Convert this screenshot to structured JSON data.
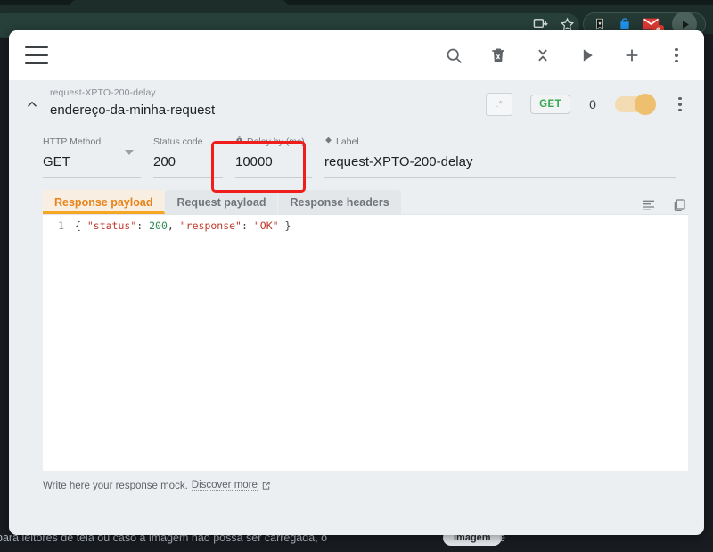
{
  "browser": {
    "icons": [
      {
        "name": "install-app-icon"
      },
      {
        "name": "bookmark-star-icon"
      },
      {
        "name": "extension-bookmark-icon"
      },
      {
        "name": "extension-shield-icon"
      },
      {
        "name": "gmail-extension-icon",
        "badge": "6"
      },
      {
        "name": "profile-avatar-icon"
      }
    ]
  },
  "toolbar": {
    "menu_label": "menu",
    "actions": [
      {
        "name": "search-icon",
        "label": "Search"
      },
      {
        "name": "delete-all-icon",
        "label": "Delete all"
      },
      {
        "name": "collapse-all-icon",
        "label": "Collapse all"
      },
      {
        "name": "run-icon",
        "label": "Run"
      },
      {
        "name": "add-icon",
        "label": "Add"
      },
      {
        "name": "more-options-icon",
        "label": "More options"
      }
    ]
  },
  "request": {
    "subtitle": "request-XPTO-200-delay",
    "title": "endereço-da-minha-request",
    "filter_value": ".*",
    "method_badge": "GET",
    "hit_count": "0",
    "enabled": true,
    "toggle_color": "#edbf6e",
    "method_color": "#34a853"
  },
  "fields": [
    {
      "name": "http-method-field",
      "label": "HTTP Method",
      "value": "GET",
      "icon": null,
      "select": true
    },
    {
      "name": "status-code-field",
      "label": "Status code",
      "value": "200",
      "icon": null,
      "select": false
    },
    {
      "name": "delay-field",
      "label": "Delay by (ms)",
      "value": "10000",
      "icon": "timer-icon",
      "select": false,
      "highlighted": true
    },
    {
      "name": "label-field",
      "label": "Label",
      "value": "request-XPTO-200-delay",
      "icon": "tag-icon",
      "select": false
    }
  ],
  "highlight_color": "#f01d1d",
  "tabs": [
    {
      "name": "tab-response-payload",
      "label": "Response payload",
      "active": true
    },
    {
      "name": "tab-request-payload",
      "label": "Request payload",
      "active": false
    },
    {
      "name": "tab-response-headers",
      "label": "Response headers",
      "active": false
    }
  ],
  "tabs_actions": [
    {
      "name": "format-code-icon",
      "label": "Format"
    },
    {
      "name": "copy-icon",
      "label": "Copy"
    }
  ],
  "editor": {
    "line_number": "1",
    "tokens": [
      {
        "t": "brace",
        "v": "{ "
      },
      {
        "t": "key",
        "v": "\"status\""
      },
      {
        "t": "colon",
        "v": ": "
      },
      {
        "t": "num",
        "v": "200"
      },
      {
        "t": "colon",
        "v": ", "
      },
      {
        "t": "key",
        "v": "\"response\""
      },
      {
        "t": "colon",
        "v": ": "
      },
      {
        "t": "str",
        "v": "\"OK\""
      },
      {
        "t": "brace",
        "v": " }"
      }
    ]
  },
  "footer": {
    "hint": "Write here your response mock.",
    "link": "Discover more",
    "link_icon": "external-link-icon"
  },
  "background_page": {
    "text_line": "para leitores de tela ou caso a imagem não possa ser carregada, o",
    "chip": "imagem",
    "trailing": "é"
  }
}
